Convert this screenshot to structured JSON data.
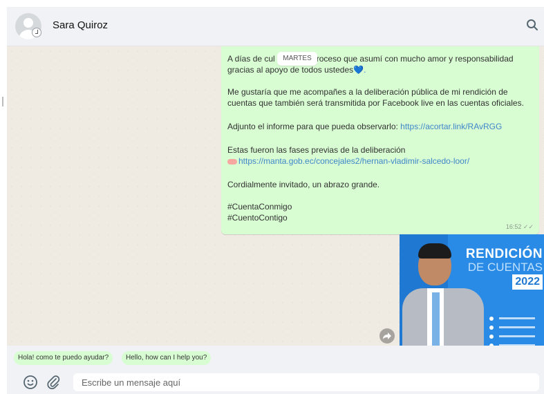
{
  "header": {
    "contact_name": "Sara Quiroz",
    "search_icon": "search-icon",
    "avatar_icon": "default-avatar-icon"
  },
  "chat": {
    "date_chip": "MARTES",
    "message": {
      "line1": "A días de cul",
      "line1_rest": "roceso que asumí con mucho amor y responsabilidad",
      "line2": "gracias al apoyo de todos ustedes",
      "line2_emoji": "💙.",
      "para2": "Me gustaría que me acompañes a la deliberación pública de mi rendición de cuentas que también será transmitida por Facebook live en las cuentas oficiales.",
      "para3_text": "Adjunto el informe para que pueda observarlo: ",
      "para3_link": "https://acortar.link/RAvRGG",
      "para4_text": "Estas fueron las fases previas de la deliberación",
      "para4_link": "https://manta.gob.ec/concejales2/hernan-vladimir-salcedo-loor/",
      "para5": "Cordialmente invitado, un abrazo grande.",
      "hashtag1": "#CuentaConmigo",
      "hashtag2": "#CuentoContigo",
      "time": "16:52 ✓✓"
    },
    "image_message": {
      "title_line1": "RENDICIÓN",
      "title_line2": "DE CUENTAS",
      "year": "2022"
    }
  },
  "quick_replies": [
    "Hola! como te puedo ayudar?",
    "Hello, how can I help you?"
  ],
  "composer": {
    "placeholder": "Escribe un mensaje aquí",
    "emoji_icon": "emoji-icon",
    "attach_icon": "paperclip-icon"
  },
  "colors": {
    "outgoing_bubble": "#d9fdd3",
    "chat_background": "#efeae2",
    "header_background": "#f0f2f5",
    "link": "#3e86c9"
  }
}
